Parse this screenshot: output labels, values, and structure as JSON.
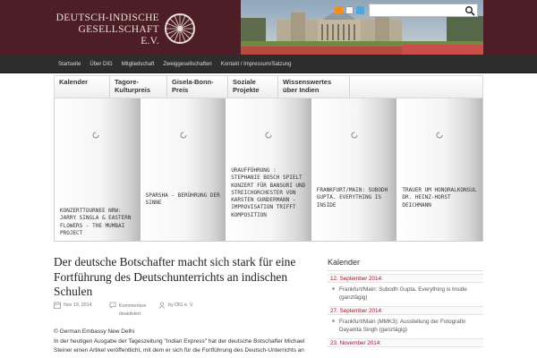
{
  "header": {
    "logo_lines": [
      "Deutsch-Indische",
      "Gesellschaft",
      "e.V."
    ],
    "social_icons": [
      "rss-icon",
      "mail-icon",
      "twitter-icon"
    ],
    "search_placeholder": ""
  },
  "topnav": {
    "items": [
      "Startseite",
      "Über DIG",
      "Mitgliedschaft",
      "Zweiggesellschaften",
      "Kontakt / Impressum/Satzung"
    ]
  },
  "catmenu": {
    "items": [
      {
        "lines": [
          "Kalender",
          ""
        ]
      },
      {
        "lines": [
          "Tagore-",
          "Kulturpreis"
        ]
      },
      {
        "lines": [
          "Gisela-Bonn-",
          "Preis"
        ]
      },
      {
        "lines": [
          "Soziale",
          "Projekte"
        ]
      },
      {
        "lines": [
          "Wissenswertes",
          "über Indien"
        ]
      }
    ]
  },
  "slider": {
    "slides": [
      {
        "title": "Konzerttournee NRW: Jarry Singla & Eastern Flowers - The Mumbai Project"
      },
      {
        "title": "Sparsha - Berührung der Sinne"
      },
      {
        "title": "Uraufführung : Stephanie Bosch spielt Konzert für Bansuri und Streichorchester von Karsten Gundermann - Improvisation trifft Komposition"
      },
      {
        "title": "Frankfurt/Main: Subodh Gupta. Everything is Inside"
      },
      {
        "title": "Trauer um Honoralkonsul Dr. Heinz-Horst Deichmann"
      }
    ]
  },
  "article": {
    "title": "Der deutsche Botschafter macht sich stark für eine Fortführung des Deutschunterrichts an indischen Schulen",
    "date": "Nov 19, 2014",
    "comments": "Kommentare deaktiviert",
    "author": "by DIG e. V.",
    "body_lines": [
      "© German Embassy New Delhi",
      "In der heutigen Ausgabe der Tageszeitung \"Indian Express\" hat der deutsche Botschafter Michael",
      "Steiner einen Artikel veröffentlicht, mit dem er sich für die Fortführung des Deutsch-Unterrichts an"
    ]
  },
  "sidebar": {
    "title": "Kalender",
    "events": [
      {
        "date": "12. September 2014:",
        "text": "Frankfurt/Main: Subodh Gupta. Everything is Inside (ganztägig)"
      },
      {
        "date": "27. September 2014:",
        "text": "Frankfurt/Main (MMK3): Ausstellung der Fotografin Dayanita Singh (ganztägig)"
      },
      {
        "date": "23. November 2014:",
        "text": ""
      }
    ]
  },
  "colors": {
    "header_bg": "#4e1e27",
    "date_accent": "#9b1b30",
    "topnav_bg": "#2d2d2d"
  }
}
